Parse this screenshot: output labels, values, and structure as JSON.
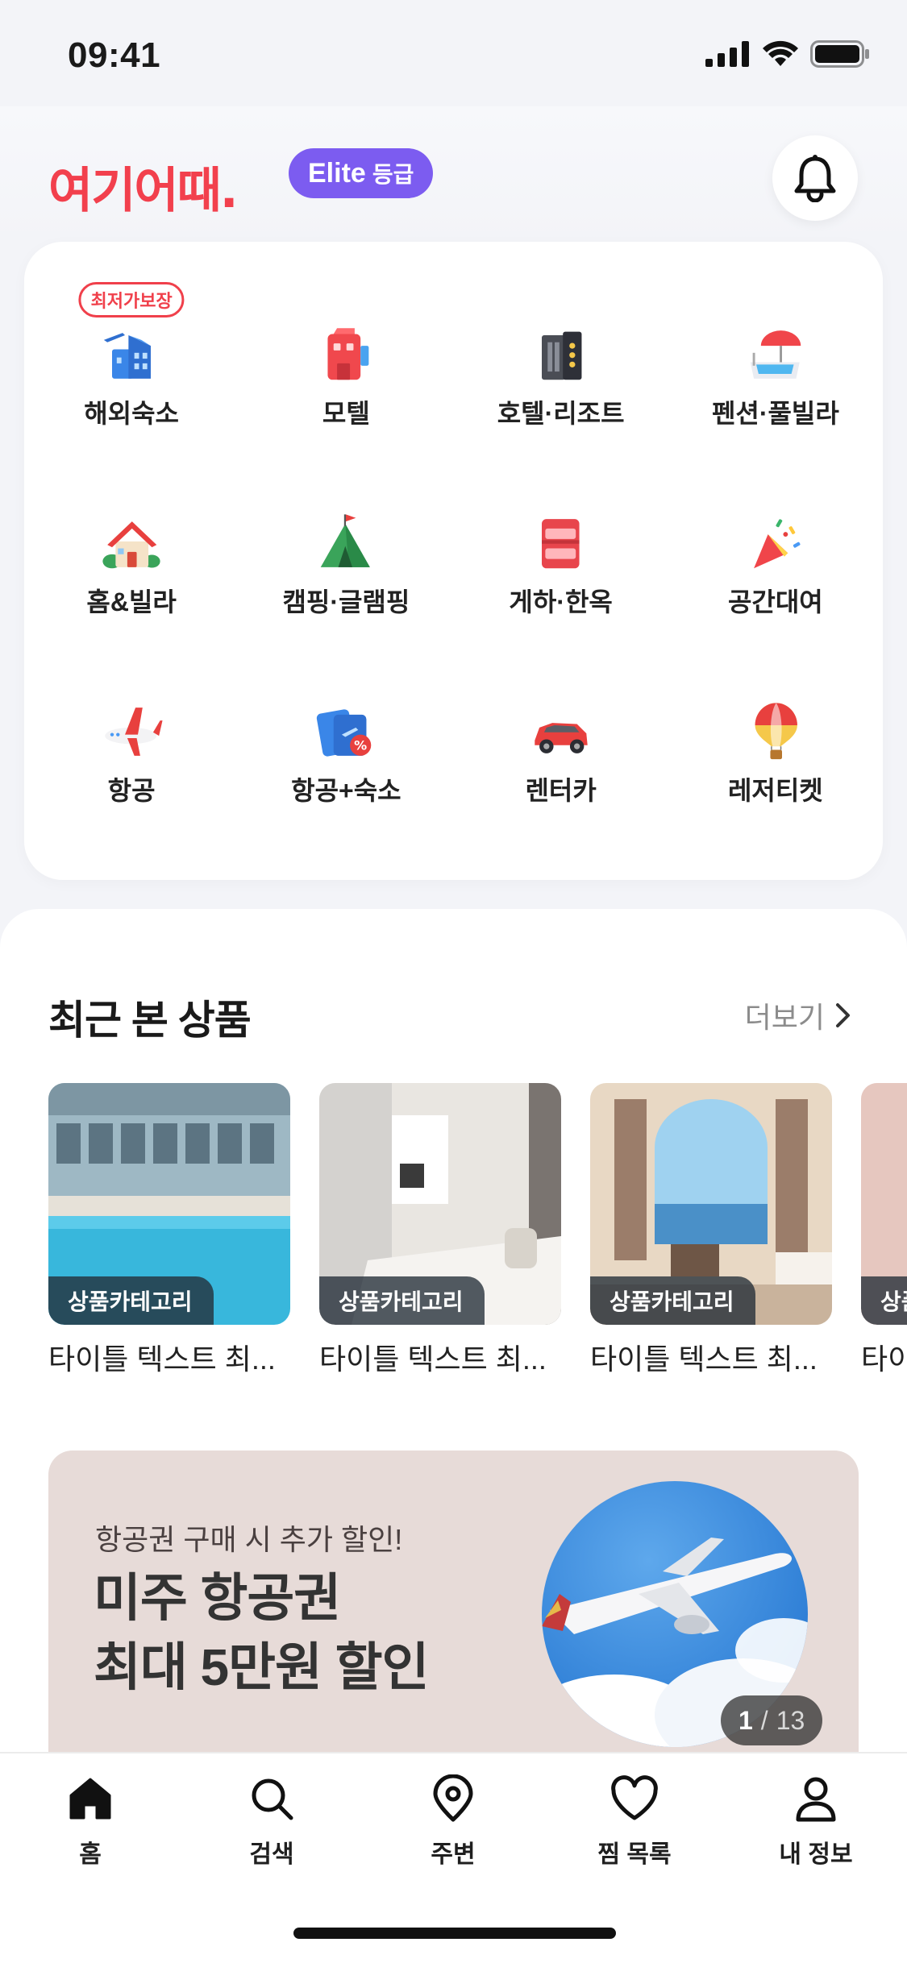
{
  "status": {
    "time": "09:41"
  },
  "header": {
    "logo": "여기어때.",
    "grade_word": "Elite",
    "grade_suffix": "등급"
  },
  "categories": [
    {
      "label": "해외숙소",
      "icon": "overseas-stay-icon",
      "tag": "최저가보장"
    },
    {
      "label": "모텔",
      "icon": "motel-icon"
    },
    {
      "label": "호텔·리조트",
      "icon": "hotel-resort-icon"
    },
    {
      "label": "펜션·풀빌라",
      "icon": "pension-poolvilla-icon"
    },
    {
      "label": "홈&빌라",
      "icon": "home-villa-icon"
    },
    {
      "label": "캠핑·글램핑",
      "icon": "camping-glamping-icon"
    },
    {
      "label": "게하·한옥",
      "icon": "guesthouse-hanok-icon"
    },
    {
      "label": "공간대여",
      "icon": "space-rental-icon"
    },
    {
      "label": "항공",
      "icon": "flight-icon"
    },
    {
      "label": "항공+숙소",
      "icon": "flight-stay-icon"
    },
    {
      "label": "렌터카",
      "icon": "rental-car-icon"
    },
    {
      "label": "레저티켓",
      "icon": "leisure-ticket-icon"
    }
  ],
  "recent": {
    "title": "최근 본 상품",
    "more_label": "더보기",
    "items": [
      {
        "category": "상품카테고리",
        "title": "타이틀 텍스트 최..."
      },
      {
        "category": "상품카테고리",
        "title": "타이틀 텍스트 최..."
      },
      {
        "category": "상품카테고리",
        "title": "타이틀 텍스트 최..."
      },
      {
        "category": "상품카테고리",
        "title": "타이틀 텍스트 최..."
      }
    ]
  },
  "banner": {
    "subtitle": "항공권 구매 시 추가 할인!",
    "title_line1": "미주 항공권",
    "title_line2": "최대 5만원 할인",
    "current": "1",
    "separator": "/",
    "total": "13"
  },
  "tabs": [
    {
      "label": "홈",
      "icon": "home-icon"
    },
    {
      "label": "검색",
      "icon": "search-icon"
    },
    {
      "label": "주변",
      "icon": "location-pin-icon"
    },
    {
      "label": "찜 목록",
      "icon": "heart-icon"
    },
    {
      "label": "내 정보",
      "icon": "user-icon"
    }
  ]
}
